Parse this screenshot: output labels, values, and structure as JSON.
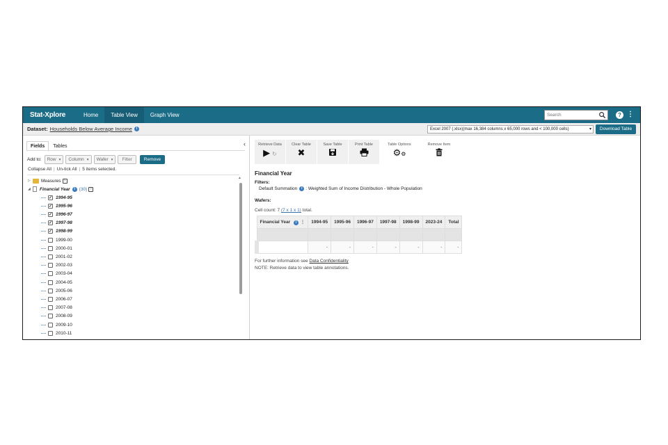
{
  "app": {
    "brand": "Stat-Xplore",
    "nav": [
      {
        "label": "Home",
        "active": false
      },
      {
        "label": "Table View",
        "active": true
      },
      {
        "label": "Graph View",
        "active": false
      }
    ],
    "search_placeholder": "Search",
    "help_icon": "?",
    "menu_icon": "⋮"
  },
  "dataset": {
    "label": "Dataset:",
    "name": "Households Below Average Income",
    "format_selected": "Excel 2007 (.xlsx)(max 16,384 columns x 65,000 rows and < 100,000 cells)",
    "download_label": "Download Table"
  },
  "left": {
    "tabs": [
      {
        "label": "Fields",
        "active": true
      },
      {
        "label": "Tables",
        "active": false
      }
    ],
    "add_to_label": "Add to:",
    "row_label": "Row",
    "column_label": "Column",
    "wafer_label": "Wafer",
    "filter_label": "Filter",
    "remove_label": "Remove",
    "collapse_all": "Collapse All",
    "untick_all": "Un-tick All",
    "items_selected": "5 items selected.",
    "measures_label": "Measures",
    "field_label": "Financial Year",
    "field_count": "(30)",
    "years": [
      {
        "label": "1994-95",
        "checked": true
      },
      {
        "label": "1995-96",
        "checked": true
      },
      {
        "label": "1996-97",
        "checked": true
      },
      {
        "label": "1997-98",
        "checked": true
      },
      {
        "label": "1998-99",
        "checked": true
      },
      {
        "label": "1999-00",
        "checked": false
      },
      {
        "label": "2000-01",
        "checked": false
      },
      {
        "label": "2001-02",
        "checked": false
      },
      {
        "label": "2002-03",
        "checked": false
      },
      {
        "label": "2003-04",
        "checked": false
      },
      {
        "label": "2004-05",
        "checked": false
      },
      {
        "label": "2005-06",
        "checked": false
      },
      {
        "label": "2006-07",
        "checked": false
      },
      {
        "label": "2007-08",
        "checked": false
      },
      {
        "label": "2008-09",
        "checked": false
      },
      {
        "label": "2009-10",
        "checked": false
      },
      {
        "label": "2010-11",
        "checked": false
      }
    ]
  },
  "toolbar": {
    "retrieve": "Retrieve Data",
    "clear": "Clear Table",
    "save": "Save Table",
    "print": "Print Table",
    "options": "Table Options",
    "remove": "Remove Item"
  },
  "table": {
    "title": "Financial Year",
    "filters_label": "Filters:",
    "filter_measure": "Default Summation",
    "filter_text": ": Weighted Sum of Income Distribution - Whole Population",
    "wafers_label": "Wafers:",
    "cell_count_prefix": "Cell count: 7",
    "cell_count_link": "(7 x 1 x 1)",
    "cell_count_suffix": "total.",
    "row_header": "Financial Year",
    "columns": [
      "1994-95",
      "1995-96",
      "1996-97",
      "1997-98",
      "1998-99",
      "2023-24",
      "Total"
    ],
    "values": [
      "-",
      "-",
      "-",
      "-",
      "-",
      "-",
      "-"
    ],
    "note_prefix": "For further information see",
    "note_link": "Data Confidentiality",
    "note2": "NOTE: Retrieve data to view table annotations."
  },
  "colors": {
    "brand": "#1b6c87",
    "active_tab": "#175d75",
    "folder": "#e5b53b"
  }
}
